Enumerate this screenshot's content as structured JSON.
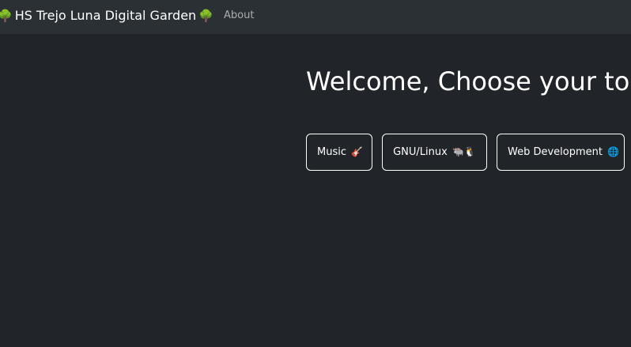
{
  "navbar": {
    "brand": {
      "emoji_left": "🌳",
      "text": "HS Trejo Luna Digital Garden",
      "emoji_right": "🌳"
    },
    "links": [
      {
        "label": "About"
      }
    ],
    "colors": {
      "background": "#2b3035",
      "link": "rgba(255,255,255,0.6)"
    }
  },
  "main": {
    "title": "Welcome, Choose your topic",
    "topics": [
      {
        "label": "Music",
        "emoji": "🎸"
      },
      {
        "label": "GNU/Linux",
        "emoji": "🐃🐧"
      },
      {
        "label": "Web Development",
        "emoji": "🌐"
      }
    ],
    "colors": {
      "background": "#212529",
      "text": "#ffffff",
      "button_border": "#ffffff"
    }
  }
}
